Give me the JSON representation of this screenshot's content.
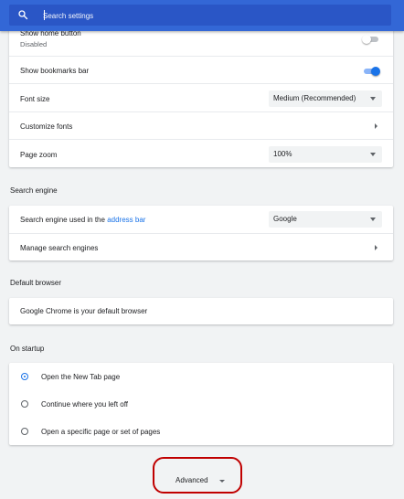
{
  "search": {
    "placeholder": "Search settings"
  },
  "appearance": {
    "home_button": {
      "label": "Show home button",
      "status": "Disabled"
    },
    "bookmarks_bar": {
      "label": "Show bookmarks bar"
    },
    "font_size": {
      "label": "Font size",
      "value": "Medium (Recommended)"
    },
    "customize_fonts": {
      "label": "Customize fonts"
    },
    "page_zoom": {
      "label": "Page zoom",
      "value": "100%"
    }
  },
  "search_engine": {
    "title": "Search engine",
    "used_label": "Search engine used in the ",
    "address_bar_link": "address bar",
    "value": "Google",
    "manage_label": "Manage search engines"
  },
  "default_browser": {
    "title": "Default browser",
    "status": "Google Chrome is your default browser"
  },
  "on_startup": {
    "title": "On startup",
    "options": [
      "Open the New Tab page",
      "Continue where you left off",
      "Open a specific page or set of pages"
    ]
  },
  "advanced": {
    "label": "Advanced"
  },
  "colors": {
    "header": "#3367d6",
    "accent": "#1a73e8",
    "annotation": "#c00000"
  }
}
